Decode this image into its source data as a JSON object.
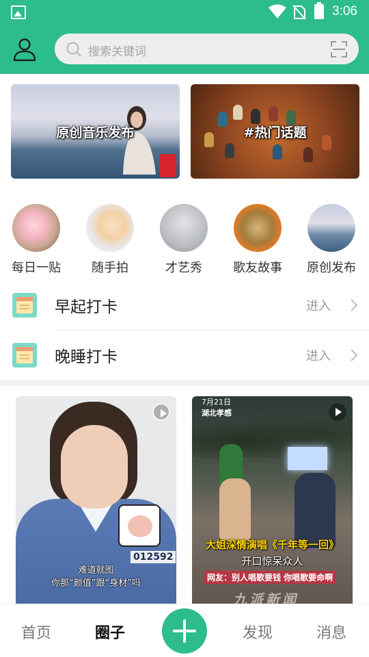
{
  "status_bar": {
    "time": "3:06"
  },
  "header": {
    "search_placeholder": "搜索关键词"
  },
  "banners": [
    {
      "caption": "原创音乐发布"
    },
    {
      "caption": "#热门话题"
    }
  ],
  "categories": [
    {
      "label": "每日一贴"
    },
    {
      "label": "随手拍"
    },
    {
      "label": "才艺秀"
    },
    {
      "label": "歌友故事"
    },
    {
      "label": "原创发布"
    }
  ],
  "checkins": [
    {
      "title": "早起打卡",
      "action": "进入"
    },
    {
      "title": "晚睡打卡",
      "action": "进入"
    }
  ],
  "videos": [
    {
      "badge": "012592",
      "subtitle_line1": "难道就图",
      "subtitle_line2": "你那“颜值”跟“身材”吗"
    },
    {
      "location_line1": "7月21日",
      "location_line2": "湖北孝感",
      "headline": "大姐深情演唱《千年等一回》",
      "subhead": "开口惊呆众人",
      "netizen_comment": "网友：别人唱歌要钱 你唱歌要命啊",
      "watermark": "九派新闻"
    }
  ],
  "bottom_nav": {
    "tabs": [
      "首页",
      "圈子",
      "发现",
      "消息"
    ],
    "active_tab": "圈子"
  },
  "colors": {
    "brand_green": "#2dbc8e",
    "page_background": "#ffffff",
    "muted_text": "#9a9a9a"
  }
}
